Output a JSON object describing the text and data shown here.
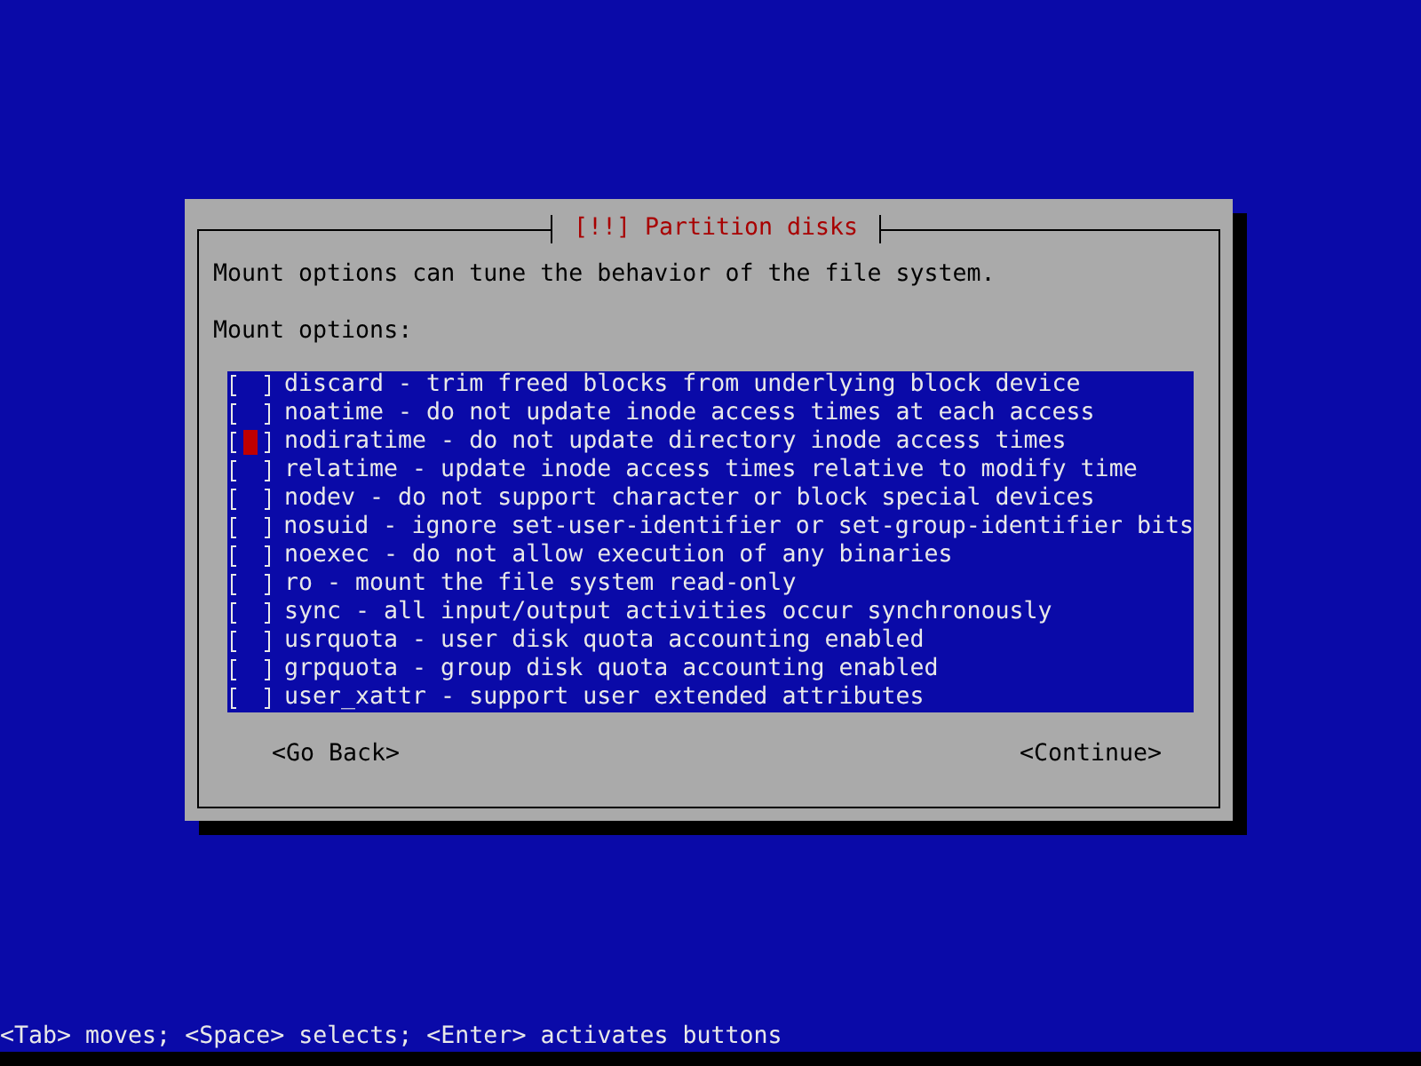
{
  "dialog": {
    "title": "[!!] Partition disks",
    "description": "Mount options can tune the behavior of the file system.",
    "list_label": "Mount options:",
    "options": [
      {
        "label": "discard - trim freed blocks from underlying block device",
        "checked": false,
        "focused": false
      },
      {
        "label": "noatime - do not update inode access times at each access",
        "checked": false,
        "focused": false
      },
      {
        "label": "nodiratime - do not update directory inode access times",
        "checked": false,
        "focused": true
      },
      {
        "label": "relatime - update inode access times relative to modify time",
        "checked": false,
        "focused": false
      },
      {
        "label": "nodev - do not support character or block special devices",
        "checked": false,
        "focused": false
      },
      {
        "label": "nosuid - ignore set-user-identifier or set-group-identifier bits",
        "checked": false,
        "focused": false
      },
      {
        "label": "noexec - do not allow execution of any binaries",
        "checked": false,
        "focused": false
      },
      {
        "label": "ro - mount the file system read-only",
        "checked": false,
        "focused": false
      },
      {
        "label": "sync - all input/output activities occur synchronously",
        "checked": false,
        "focused": false
      },
      {
        "label": "usrquota - user disk quota accounting enabled",
        "checked": false,
        "focused": false
      },
      {
        "label": "grpquota - group disk quota accounting enabled",
        "checked": false,
        "focused": false
      },
      {
        "label": "user_xattr - support user extended attributes",
        "checked": false,
        "focused": false
      }
    ],
    "buttons": [
      {
        "label": "<Go Back>"
      },
      {
        "label": "<Continue>"
      }
    ]
  },
  "status_bar": "<Tab> moves; <Space> selects; <Enter> activates buttons"
}
